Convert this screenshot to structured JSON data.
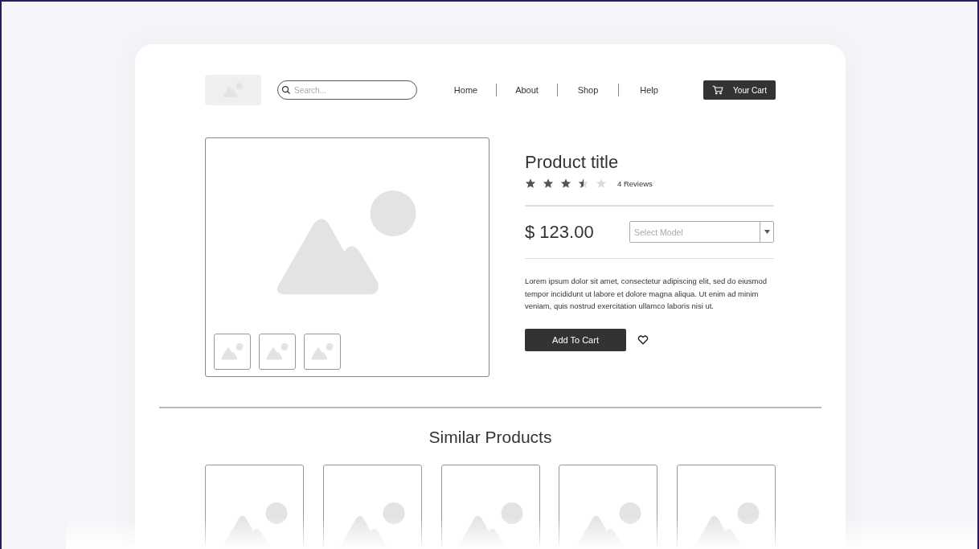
{
  "header": {
    "search": {
      "placeholder": "Search..."
    },
    "nav": [
      {
        "label": "Home"
      },
      {
        "label": "About"
      },
      {
        "label": "Shop"
      },
      {
        "label": "Help"
      }
    ],
    "cart_button": "Your Cart"
  },
  "product": {
    "title": "Product title",
    "stars": 3.5,
    "reviews": "4 Reviews",
    "price": "$ 123.00",
    "model_select": {
      "placeholder": "Select Model"
    },
    "description": "Lorem ipsum dolor sit amet, consectetur adipiscing elit, sed do eiusmod tempor incididunt ut labore et dolore magna aliqua. Ut enim ad minim veniam, quis nostrud exercitation ullamco laboris nisi ut.",
    "add_button": "Add To Cart"
  },
  "similar": {
    "title": "Similar Products"
  }
}
